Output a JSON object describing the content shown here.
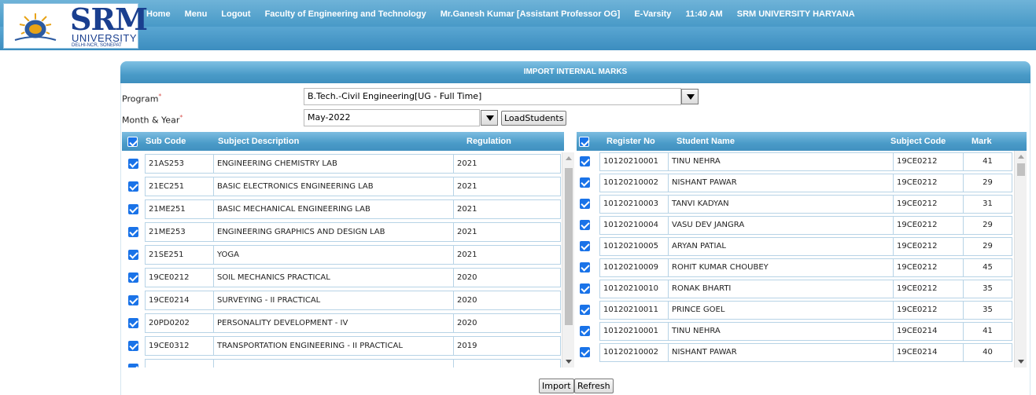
{
  "logo": {
    "name": "SRM",
    "line2": "UNIVERSITY",
    "line3": "DELHI-NCR, SONEPAT"
  },
  "nav": [
    "Home",
    "Menu",
    "Logout",
    "Faculty of Engineering and Technology",
    "Mr.Ganesh Kumar [Assistant Professor OG]",
    "E-Varsity",
    "11:40 AM",
    "SRM UNIVERSITY HARYANA"
  ],
  "panel": {
    "title": "IMPORT INTERNAL MARKS"
  },
  "form": {
    "program_label": "Program",
    "program_value": "B.Tech.-Civil Engineering[UG - Full Time]",
    "month_label": "Month & Year",
    "month_value": "May-2022",
    "load_button": "LoadStudents",
    "required_mark": "*"
  },
  "subjects": {
    "headers": [
      "Sub Code",
      "Subject Description",
      "Regulation"
    ],
    "rows": [
      [
        "21AS253",
        "ENGINEERING CHEMISTRY LAB",
        "2021"
      ],
      [
        "21EC251",
        "BASIC ELECTRONICS ENGINEERING LAB",
        "2021"
      ],
      [
        "21ME251",
        "BASIC MECHANICAL ENGINEERING LAB",
        "2021"
      ],
      [
        "21ME253",
        "ENGINEERING GRAPHICS AND DESIGN LAB",
        "2021"
      ],
      [
        "21SE251",
        "YOGA",
        "2021"
      ],
      [
        "19CE0212",
        "SOIL MECHANICS PRACTICAL",
        "2020"
      ],
      [
        "19CE0214",
        "SURVEYING - II PRACTICAL",
        "2020"
      ],
      [
        "20PD0202",
        "PERSONALITY DEVELOPMENT - IV",
        "2020"
      ],
      [
        "19CE0312",
        "TRANSPORTATION ENGINEERING - II PRACTICAL",
        "2019"
      ]
    ]
  },
  "students": {
    "headers": [
      "Register No",
      "Student Name",
      "Subject Code",
      "Mark"
    ],
    "rows": [
      [
        "10120210001",
        "TINU NEHRA",
        "19CE0212",
        "41"
      ],
      [
        "10120210002",
        "NISHANT PAWAR",
        "19CE0212",
        "29"
      ],
      [
        "10120210003",
        "TANVI KADYAN",
        "19CE0212",
        "31"
      ],
      [
        "10120210004",
        "VASU DEV JANGRA",
        "19CE0212",
        "29"
      ],
      [
        "10120210005",
        "ARYAN PATIAL",
        "19CE0212",
        "29"
      ],
      [
        "10120210009",
        "ROHIT KUMAR CHOUBEY",
        "19CE0212",
        "45"
      ],
      [
        "10120210010",
        "RONAK BHARTI",
        "19CE0212",
        "35"
      ],
      [
        "10120210011",
        "PRINCE GOEL",
        "19CE0212",
        "35"
      ],
      [
        "10120210001",
        "TINU NEHRA",
        "19CE0214",
        "41"
      ],
      [
        "10120210002",
        "NISHANT PAWAR",
        "19CE0214",
        "40"
      ]
    ]
  },
  "actions": {
    "import": "Import",
    "refresh": "Refresh"
  },
  "colors": {
    "header_blue": "#4a9bc8",
    "checkbox_blue": "#1a73e8"
  },
  "icons": {
    "dropdown": "triangle-down-icon",
    "checkbox": "checkbox-checked-icon"
  }
}
